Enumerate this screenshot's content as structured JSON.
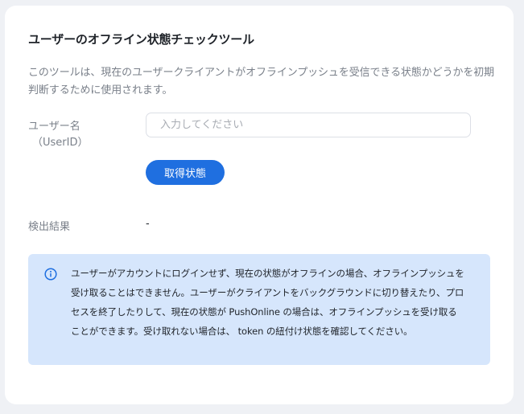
{
  "page": {
    "title": "ユーザーのオフライン状態チェックツール",
    "description": "このツールは、現在のユーザークライアントがオフラインプッシュを受信できる状態かどうかを初期判断するために使用されます。"
  },
  "form": {
    "user_label": "ユーザー名",
    "user_sub_label": "（UserID）",
    "user_placeholder": "入力してください",
    "user_value": "",
    "submit_label": "取得状態"
  },
  "result": {
    "label": "検出結果",
    "value": "-"
  },
  "notice": {
    "icon": "info-icon",
    "accent_color": "#1f6fe0",
    "background_color": "#d6e6fc",
    "text": "ユーザーがアカウントにログインせず、現在の状態がオフラインの場合、オフラインプッシュを受け取ることはできません。ユーザーがクライアントをバックグラウンドに切り替えたり、プロセスを終了したりして、現在の状態が PushOnline の場合は、オフラインプッシュを受け取ることができます。受け取れない場合は、 token の紐付け状態を確認してください。"
  }
}
